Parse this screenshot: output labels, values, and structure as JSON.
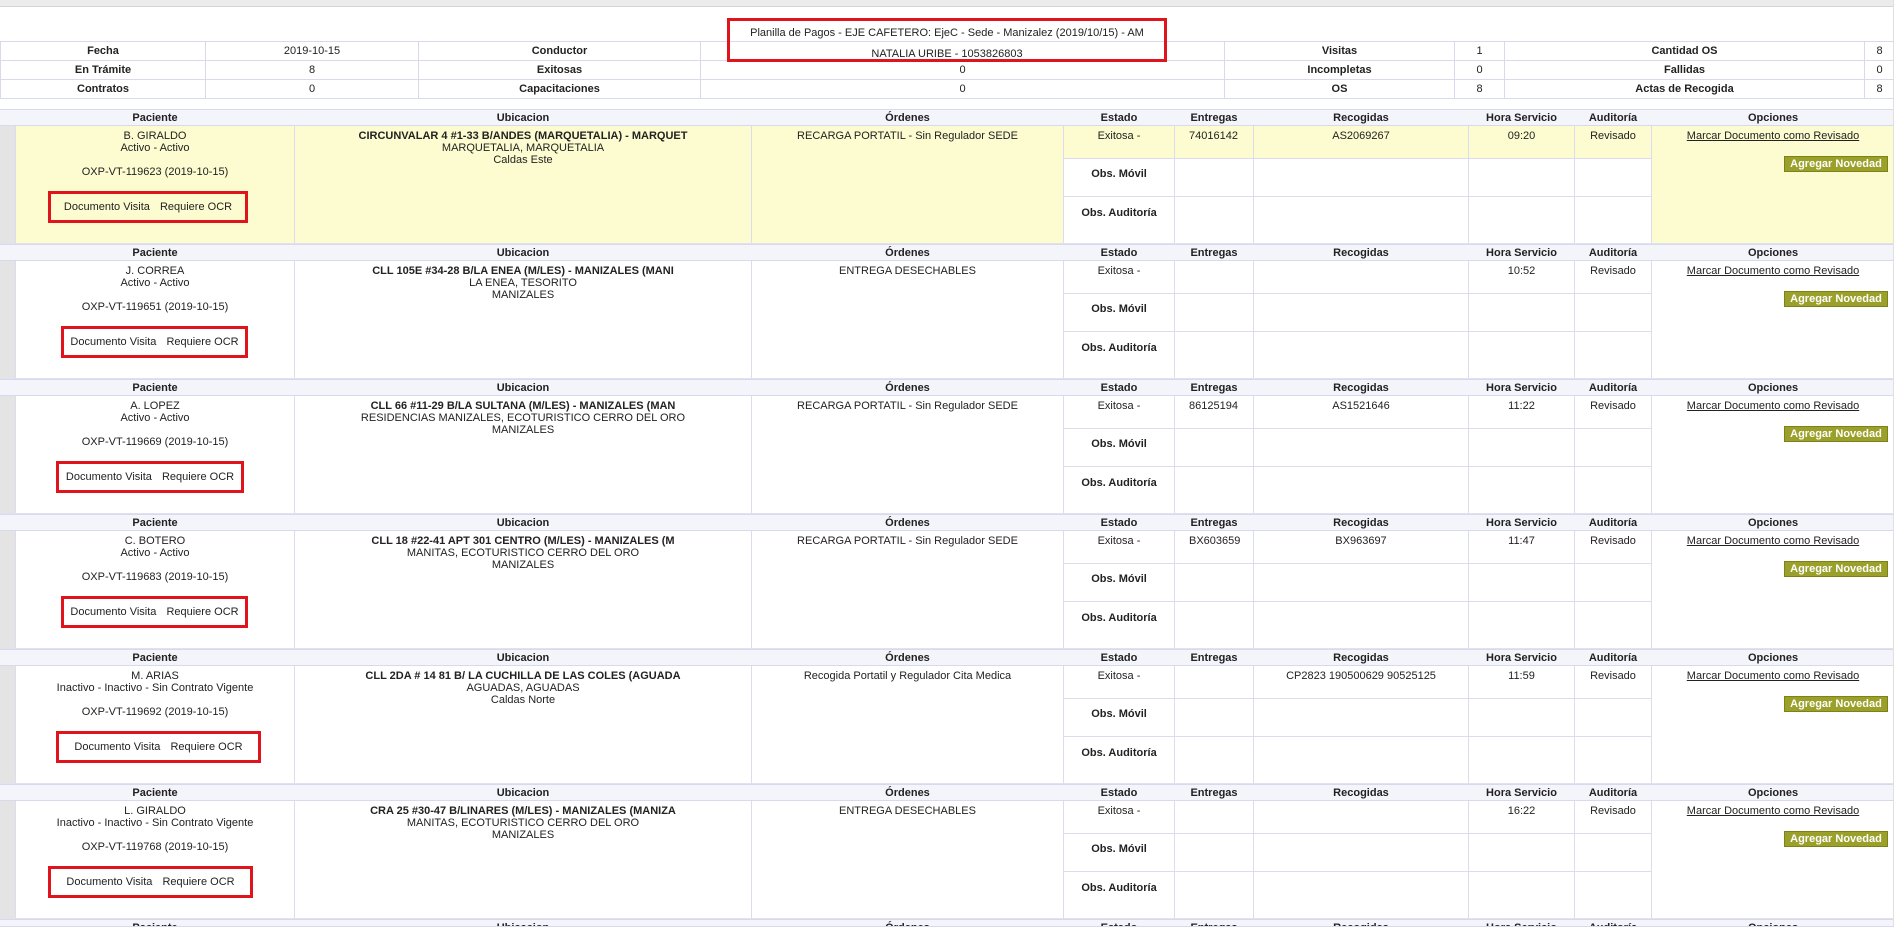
{
  "summary": {
    "title": "Planilla de Pagos - EJE CAFETERO: EjeC - Sede - Manizalez (2019/10/15) - AM",
    "conductor_value": "NATALIA URIBE - 1053826803",
    "rows": [
      [
        {
          "label": "Fecha",
          "value": "2019-10-15"
        },
        {
          "label": "Conductor",
          "value": ""
        },
        {
          "label": "Visitas",
          "value": "1"
        },
        {
          "label": "Cantidad OS",
          "value": "8"
        }
      ],
      [
        {
          "label": "En Trámite",
          "value": "8"
        },
        {
          "label": "Exitosas",
          "value": "0"
        },
        {
          "label": "Incompletas",
          "value": "0"
        },
        {
          "label": "Fallidas",
          "value": "0"
        }
      ],
      [
        {
          "label": "Contratos",
          "value": "0"
        },
        {
          "label": "Capacitaciones",
          "value": "0"
        },
        {
          "label": "OS",
          "value": "8"
        },
        {
          "label": "Actas de Recogida",
          "value": "8"
        }
      ]
    ]
  },
  "headers": {
    "paciente": "Paciente",
    "ubicacion": "Ubicacion",
    "ordenes": "Órdenes",
    "estado": "Estado",
    "entregas": "Entregas",
    "recogidas": "Recogidas",
    "hora": "Hora Servicio",
    "auditoria": "Auditoría",
    "opciones": "Opciones"
  },
  "labels": {
    "documento_visita": "Documento Visita",
    "requiere_ocr": "Requiere OCR",
    "obs_movil": "Obs. Móvil",
    "obs_auditoria": "Obs. Auditoría",
    "marcar": "Marcar Documento como Revisado",
    "agregar": "Agregar Novedad"
  },
  "colors": {
    "highlight_box": "#e0141c",
    "selected_row": "#fcfcd0",
    "agregar_button": "#9aa02a"
  },
  "records": [
    {
      "name": "B. GIRALDO",
      "status": "Activo - Activo",
      "os": "OXP-VT-119623 (2019-10-15)",
      "addr": "CIRCUNVALAR 4 #1-33 B/ANDES (MARQUETALIA) - MARQUET",
      "line2": "MARQUETALIA, MARQUETALIA",
      "line3": "Caldas Este",
      "orden": "RECARGA PORTATIL - Sin Regulador SEDE",
      "estado": "Exitosa -",
      "entregas": "74016142",
      "recogidas": "AS2069267",
      "hora": "09:20",
      "auditoria": "Revisado"
    },
    {
      "name": "J. CORREA",
      "status": "Activo - Activo",
      "os": "OXP-VT-119651 (2019-10-15)",
      "addr": "CLL 105E #34-28 B/LA ENEA (M/LES) - MANIZALES (MANI",
      "line2": "LA ENEA, TESORITO",
      "line3": "MANIZALES",
      "orden": "ENTREGA DESECHABLES",
      "estado": "Exitosa -",
      "entregas": "",
      "recogidas": "",
      "hora": "10:52",
      "auditoria": "Revisado"
    },
    {
      "name": "A. LOPEZ",
      "status": "Activo - Activo",
      "os": "OXP-VT-119669 (2019-10-15)",
      "addr": "CLL 66 #11-29 B/LA SULTANA (M/LES) - MANIZALES (MAN",
      "line2": "RESIDENCIAS MANIZALES, ECOTURISTICO CERRO DEL ORO",
      "line3": "MANIZALES",
      "orden": "RECARGA PORTATIL - Sin Regulador SEDE",
      "estado": "Exitosa -",
      "entregas": "86125194",
      "recogidas": "AS1521646",
      "hora": "11:22",
      "auditoria": "Revisado"
    },
    {
      "name": "C. BOTERO",
      "status": "Activo - Activo",
      "os": "OXP-VT-119683 (2019-10-15)",
      "addr": "CLL 18 #22-41 APT 301 CENTRO (M/LES) - MANIZALES (M",
      "line2": "MANITAS, ECOTURISTICO CERRO DEL ORO",
      "line3": "MANIZALES",
      "orden": "RECARGA PORTATIL - Sin Regulador SEDE",
      "estado": "Exitosa -",
      "entregas": "BX603659",
      "recogidas": "BX963697",
      "hora": "11:47",
      "auditoria": "Revisado"
    },
    {
      "name": "M. ARIAS",
      "status": "Inactivo - Inactivo - Sin Contrato Vigente",
      "os": "OXP-VT-119692 (2019-10-15)",
      "addr": "CLL 2DA # 14 81 B/ LA CUCHILLA DE LAS COLES (AGUADA",
      "line2": "AGUADAS, AGUADAS",
      "line3": "Caldas Norte",
      "orden": "Recogida Portatil y Regulador Cita Medica",
      "estado": "Exitosa -",
      "entregas": "",
      "recogidas": "CP2823 190500629 90525125",
      "hora": "11:59",
      "auditoria": "Revisado"
    },
    {
      "name": "L. GIRALDO",
      "status": "Inactivo - Inactivo - Sin Contrato Vigente",
      "os": "OXP-VT-119768 (2019-10-15)",
      "addr": "CRA 25 #30-47 B/LINARES (M/LES) - MANIZALES (MANIZA",
      "line2": "MANITAS, ECOTURISTICO CERRO DEL ORO",
      "line3": "MANIZALES",
      "orden": "ENTREGA DESECHABLES",
      "estado": "Exitosa -",
      "entregas": "",
      "recogidas": "",
      "hora": "16:22",
      "auditoria": "Revisado"
    }
  ]
}
